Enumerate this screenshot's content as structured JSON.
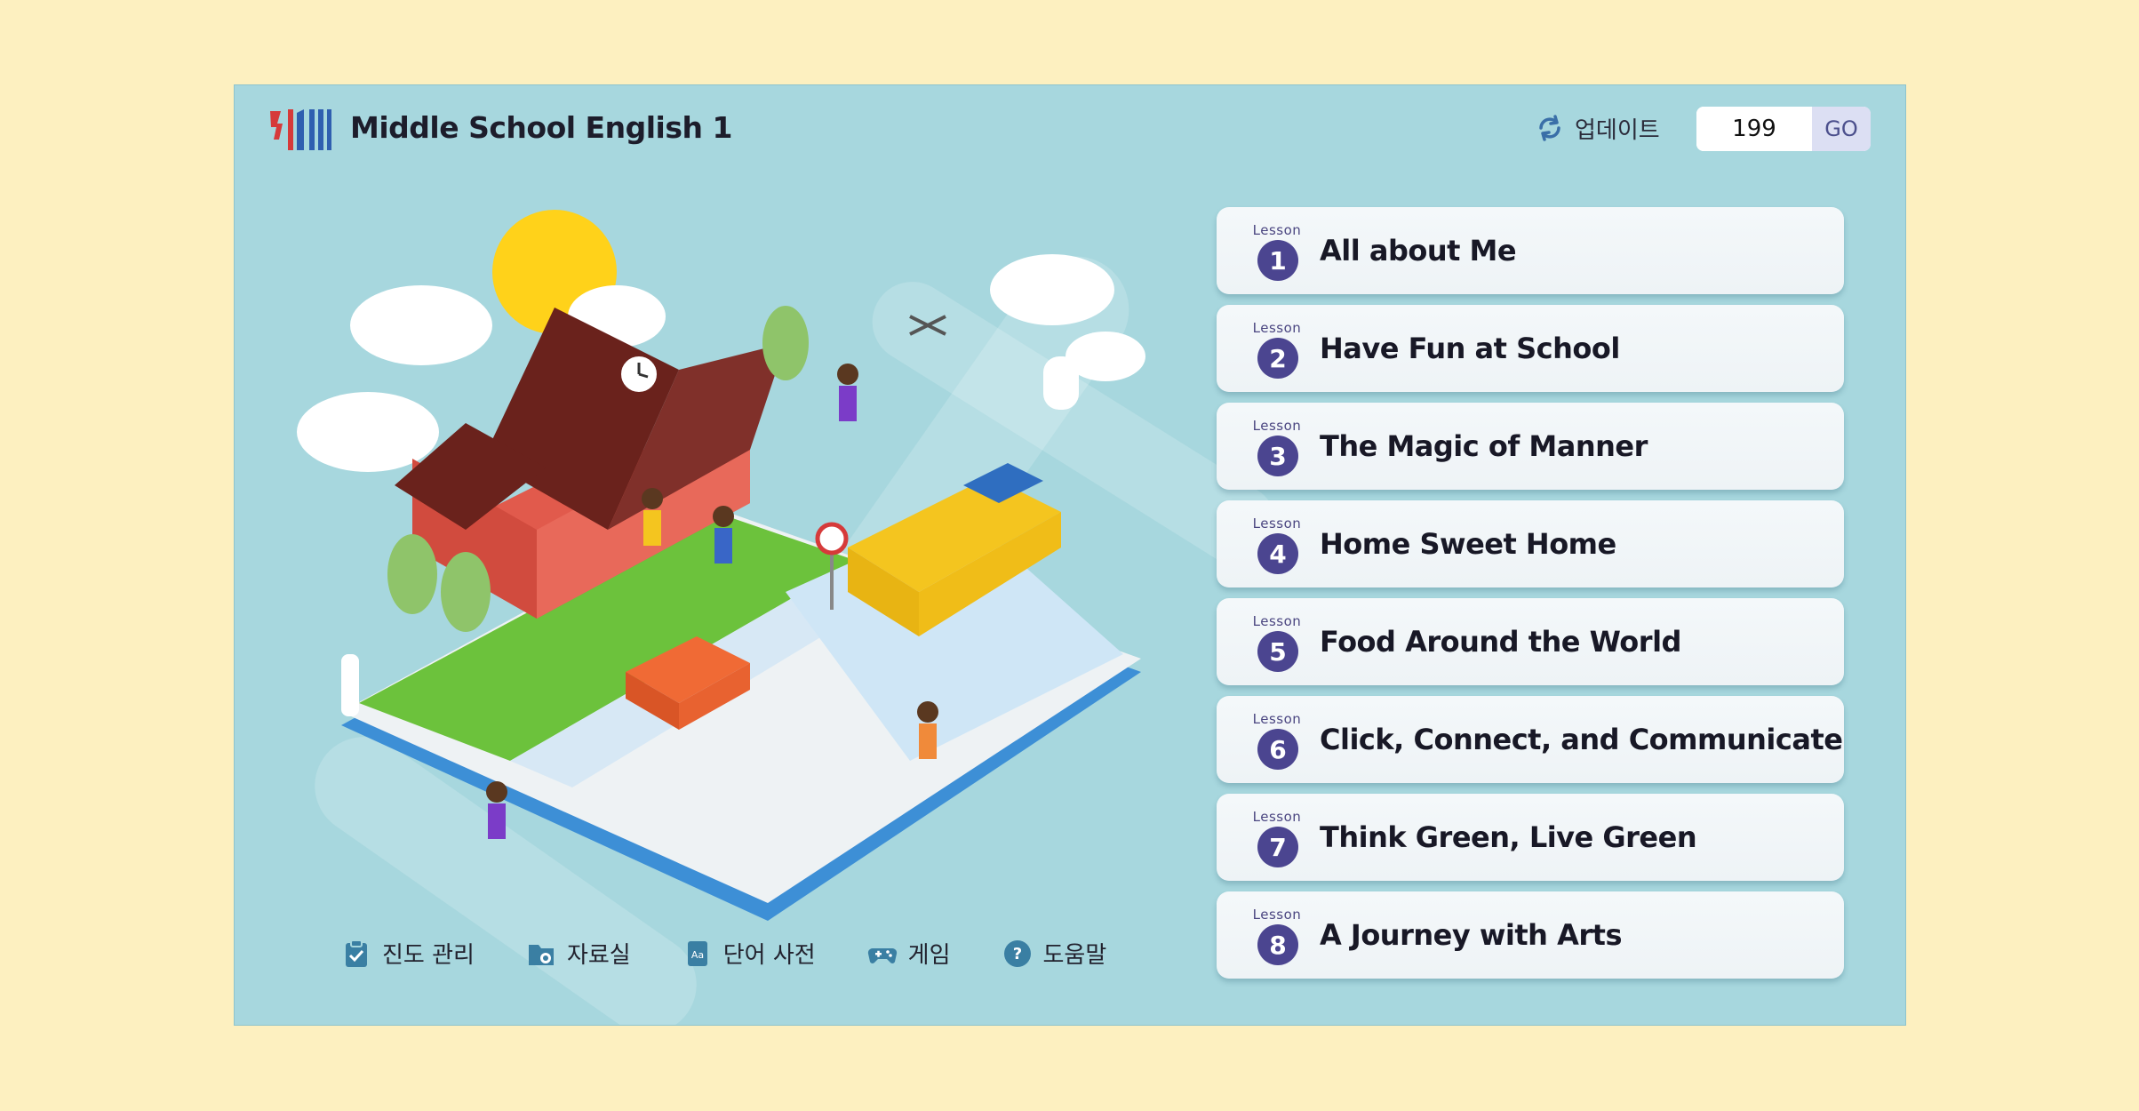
{
  "header": {
    "title": "Middle School English 1",
    "update_label": "업데이트",
    "page_value": "199",
    "go_label": "GO"
  },
  "lessons": [
    {
      "word": "Lesson",
      "number": "1",
      "title": "All about Me"
    },
    {
      "word": "Lesson",
      "number": "2",
      "title": "Have Fun at School"
    },
    {
      "word": "Lesson",
      "number": "3",
      "title": "The Magic of Manner"
    },
    {
      "word": "Lesson",
      "number": "4",
      "title": "Home Sweet Home"
    },
    {
      "word": "Lesson",
      "number": "5",
      "title": "Food Around the World"
    },
    {
      "word": "Lesson",
      "number": "6",
      "title": "Click, Connect, and Communicate"
    },
    {
      "word": "Lesson",
      "number": "7",
      "title": "Think Green, Live Green"
    },
    {
      "word": "Lesson",
      "number": "8",
      "title": "A Journey with Arts"
    }
  ],
  "menu": [
    {
      "label": "진도 관리",
      "icon": "clipboard-check-icon"
    },
    {
      "label": "자료실",
      "icon": "folder-icon"
    },
    {
      "label": "단어 사전",
      "icon": "dictionary-icon"
    },
    {
      "label": "게임",
      "icon": "gamepad-icon"
    },
    {
      "label": "도움말",
      "icon": "help-icon"
    }
  ],
  "colors": {
    "background": "#fdf0c0",
    "panel": "#a7d7de",
    "accent": "#4b4590"
  }
}
